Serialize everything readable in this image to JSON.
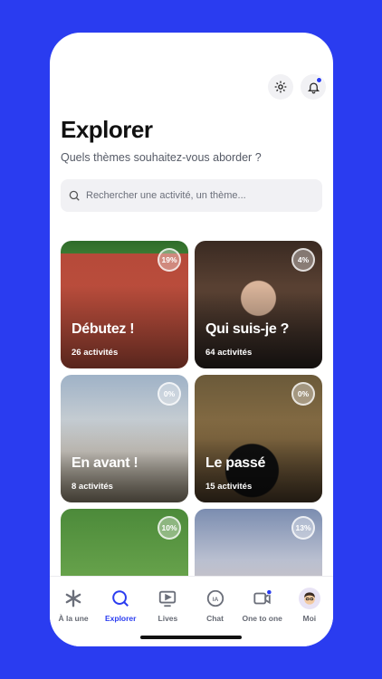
{
  "header": {
    "title": "Explorer",
    "subtitle": "Quels thèmes souhaitez-vous aborder ?"
  },
  "search": {
    "placeholder": "Rechercher une activité, un thème..."
  },
  "cards": [
    {
      "title": "Débutez !",
      "count": "26 activités",
      "progress": "19%"
    },
    {
      "title": "Qui suis-je ?",
      "count": "64 activités",
      "progress": "4%"
    },
    {
      "title": "En avant !",
      "count": "8 activités",
      "progress": "0%"
    },
    {
      "title": "Le passé",
      "count": "15 activités",
      "progress": "0%"
    },
    {
      "title": "",
      "count": "",
      "progress": "10%"
    },
    {
      "title": "",
      "count": "",
      "progress": "13%"
    }
  ],
  "tabs": [
    {
      "label": "À la une",
      "icon": "asterisk-icon"
    },
    {
      "label": "Explorer",
      "icon": "search-icon"
    },
    {
      "label": "Lives",
      "icon": "play-screen-icon"
    },
    {
      "label": "Chat",
      "icon": "ia-chat-icon"
    },
    {
      "label": "One to one",
      "icon": "video-camera-icon"
    },
    {
      "label": "Moi",
      "icon": "avatar-icon"
    }
  ],
  "colors": {
    "accent": "#2a3cf0",
    "background": "#2a3cf0"
  }
}
